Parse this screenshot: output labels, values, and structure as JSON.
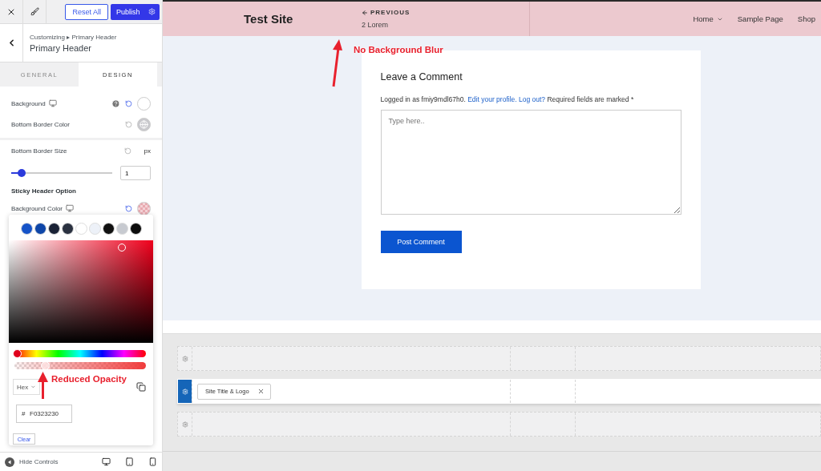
{
  "toolbar": {
    "reset": "Reset All",
    "publish": "Publish"
  },
  "panel": {
    "breadcrumb": "Customizing ▸ Primary Header",
    "title": "Primary Header"
  },
  "tabs": [
    {
      "label": "GENERAL",
      "selected": false
    },
    {
      "label": "DESIGN",
      "selected": true
    }
  ],
  "settings": [
    {
      "kind": "color",
      "label": "Background",
      "device": true,
      "help": true,
      "modified": true,
      "swatch": {
        "kind": "white"
      }
    },
    {
      "kind": "color",
      "label": "Bottom Border Color",
      "device": false,
      "help": false,
      "modified": false,
      "swatch": {
        "kind": "unset"
      }
    },
    {
      "kind": "size",
      "label": "Bottom Border Size",
      "modified": false,
      "unit": "px",
      "value": "1",
      "level": 0.1
    },
    {
      "kind": "heading",
      "label": "Sticky Header Option"
    },
    {
      "kind": "color",
      "label": "Background Color",
      "device": true,
      "help": false,
      "modified": true,
      "swatch": {
        "kind": "transparent"
      }
    }
  ],
  "color_picker": {
    "swatches": [
      {
        "color": "#1553c8"
      },
      {
        "color": "#0e46a8"
      },
      {
        "color": "#1a2236"
      },
      {
        "color": "#2a3140"
      },
      {
        "color": "#ffffff"
      },
      {
        "color": "#edf1f8"
      },
      {
        "color": "#111111"
      },
      {
        "color": "#c7cad0"
      },
      {
        "color": "#0d0d0d"
      }
    ],
    "hue": {
      "level": 0.02
    },
    "opacity": {
      "level": 0.23
    },
    "format": "Hex",
    "prefix": "#",
    "value": "F0323230",
    "clear": "Clear"
  },
  "footer": {
    "hide_controls": "Hide Controls"
  },
  "site_header": {
    "title": "Test Site",
    "previous": "PREVIOUS",
    "previous_post": "2 Lorem",
    "menu": [
      {
        "label": "Home",
        "has_submenu": true
      },
      {
        "label": "Sample Page",
        "has_submenu": false
      },
      {
        "label": "Shop",
        "has_submenu": false
      }
    ]
  },
  "comment_form": {
    "heading": "Leave a Comment",
    "logged_in": "Logged in as fmiy9mdl67h0.",
    "edit_profile": "Edit your profile.",
    "logout": "Log out?",
    "required": "Required fields are marked *",
    "placeholder": "Type here..",
    "submit": "Post Comment"
  },
  "builder_rows": [
    {
      "selected": false,
      "items": []
    },
    {
      "selected": true,
      "items": [
        "Site Title & Logo"
      ]
    },
    {
      "selected": false,
      "items": []
    }
  ],
  "annotations": [
    {
      "text": "No Background Blur"
    },
    {
      "text": "Reduced Opacity"
    }
  ]
}
